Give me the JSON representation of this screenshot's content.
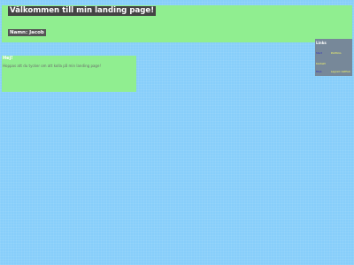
{
  "header": {
    "title": "Välkommen till min landing page!",
    "name_label": "Namn: Jacob"
  },
  "content": {
    "greeting": "Hej!",
    "text": "Hoppas att du tycker om att kolla på min landing page!"
  },
  "links": {
    "title": "Links",
    "items": [
      {
        "label": "Start",
        "value": "Portfolio"
      },
      {
        "label": "Kontakt",
        "value": ""
      },
      {
        "label": "Miljö",
        "value": "Lagrad i GitHub"
      }
    ]
  },
  "colors": {
    "background": "#87cefa",
    "panel": "#90ee90",
    "links_panel": "#778899",
    "title_bg": "#444444"
  }
}
